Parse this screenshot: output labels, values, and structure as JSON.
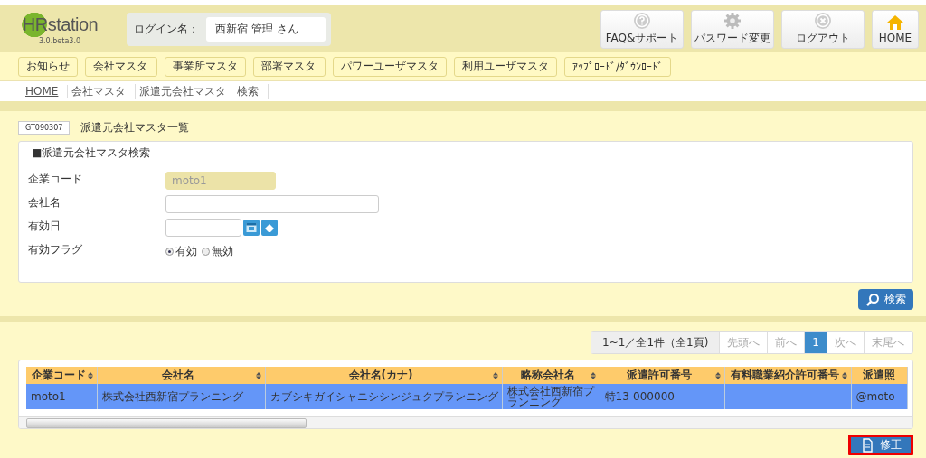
{
  "header": {
    "logo": "HRstation",
    "version": "3.0.beta3.0",
    "login_label": "ログイン名：",
    "login_user": "西新宿 管理 さん",
    "buttons": [
      {
        "kind": "help",
        "label": "FAQ&サポート"
      },
      {
        "kind": "gear",
        "label": "パスワード変更"
      },
      {
        "kind": "close",
        "label": "ログアウト"
      },
      {
        "kind": "home",
        "label": "HOME"
      }
    ]
  },
  "nav": [
    "お知らせ",
    "会社マスタ",
    "事業所マスタ",
    "部署マスタ",
    "パワーユーザマスタ",
    "利用ユーザマスタ",
    "ｱｯﾌﾟﾛｰﾄﾞ/ﾀﾞｳﾝﾛｰﾄﾞ"
  ],
  "breadcrumb": [
    {
      "label": "HOME",
      "link": true
    },
    {
      "label": "会社マスタ",
      "link": false
    },
    {
      "label": "派遣元会社マスタ　検索",
      "link": false
    }
  ],
  "page": {
    "code": "GT090307",
    "title": "派遣元会社マスタ一覧"
  },
  "search_panel": {
    "title": "■派遣元会社マスタ検索",
    "fields": [
      {
        "kind": "text",
        "label": "企業コード",
        "value": "moto1",
        "disabled": true
      },
      {
        "kind": "text",
        "label": "会社名"
      },
      {
        "kind": "date",
        "label": "有効日"
      },
      {
        "kind": "radio",
        "label": "有効フラグ",
        "options": [
          {
            "label": "有効",
            "selected": true
          },
          {
            "label": "無効",
            "selected": false
          }
        ]
      }
    ],
    "search_button": "検索"
  },
  "pagination": {
    "summary": "1~1／全1件（全1頁)",
    "pages": [
      {
        "label": "先頭へ",
        "selected": false
      },
      {
        "label": "前へ",
        "selected": false
      },
      {
        "label": "1",
        "selected": true
      },
      {
        "label": "次へ",
        "selected": false
      },
      {
        "label": "末尾へ",
        "selected": false
      }
    ]
  },
  "table": {
    "columns": [
      "企業コード",
      "会社名",
      "会社名(カナ)",
      "略称会社名",
      "派遣許可番号",
      "有料職業紹介許可番号",
      "派遣照"
    ],
    "rows": [
      {
        "selected": true,
        "cells": [
          "moto1",
          "株式会社西新宿プランニング",
          "カブシキガイシャニシシンジュクプランニング",
          "株式会社西新宿プランニング",
          "特13-000000",
          "",
          "@moto"
        ]
      }
    ]
  },
  "edit_button": "修正"
}
